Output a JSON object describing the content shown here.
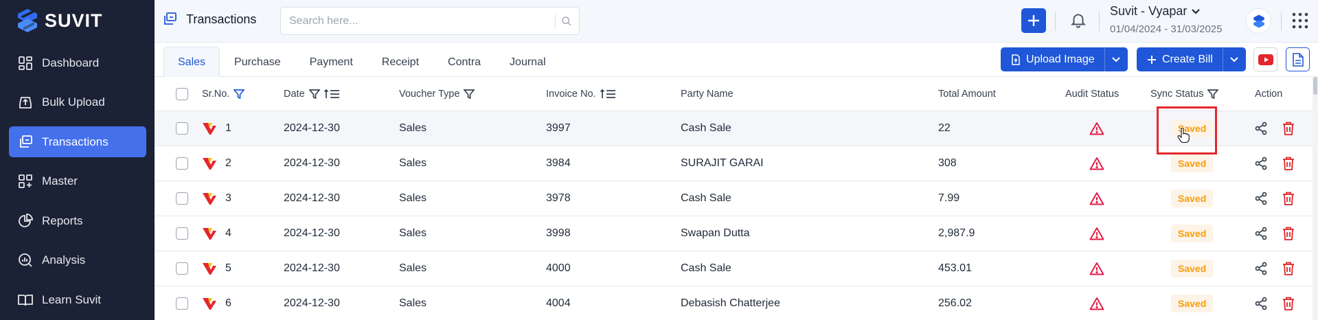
{
  "brand": {
    "name": "SUVIT"
  },
  "sidebar": {
    "items": [
      {
        "label": "Dashboard",
        "icon": "dashboard-icon",
        "active": false
      },
      {
        "label": "Bulk Upload",
        "icon": "upload-icon",
        "active": false
      },
      {
        "label": "Transactions",
        "icon": "transactions-icon",
        "active": true
      },
      {
        "label": "Master",
        "icon": "master-icon",
        "active": false
      },
      {
        "label": "Reports",
        "icon": "reports-icon",
        "active": false
      },
      {
        "label": "Analysis",
        "icon": "analysis-icon",
        "active": false
      },
      {
        "label": "Learn Suvit",
        "icon": "book-icon",
        "active": false
      }
    ]
  },
  "header": {
    "title": "Transactions",
    "search_placeholder": "Search here...",
    "company_name": "Suvit - Vyapar",
    "period": "01/04/2024 - 31/03/2025"
  },
  "tabs": [
    {
      "label": "Sales",
      "active": true
    },
    {
      "label": "Purchase",
      "active": false
    },
    {
      "label": "Payment",
      "active": false
    },
    {
      "label": "Receipt",
      "active": false
    },
    {
      "label": "Contra",
      "active": false
    },
    {
      "label": "Journal",
      "active": false
    }
  ],
  "actions": {
    "upload_image": "Upload Image",
    "create_bill": "Create Bill"
  },
  "table": {
    "columns": [
      "Sr.No.",
      "Date",
      "Voucher Type",
      "Invoice No.",
      "Party Name",
      "Total Amount",
      "Audit Status",
      "Sync Status",
      "Action"
    ],
    "rows": [
      {
        "sr": "1",
        "date": "2024-12-30",
        "voucher": "Sales",
        "invoice": "3997",
        "party": "Cash Sale",
        "amount": "22",
        "sync": "Saved"
      },
      {
        "sr": "2",
        "date": "2024-12-30",
        "voucher": "Sales",
        "invoice": "3984",
        "party": "SURAJIT GARAI",
        "amount": "308",
        "sync": "Saved"
      },
      {
        "sr": "3",
        "date": "2024-12-30",
        "voucher": "Sales",
        "invoice": "3978",
        "party": "Cash Sale",
        "amount": "7.99",
        "sync": "Saved"
      },
      {
        "sr": "4",
        "date": "2024-12-30",
        "voucher": "Sales",
        "invoice": "3998",
        "party": "Swapan Dutta",
        "amount": "2,987.9",
        "sync": "Saved"
      },
      {
        "sr": "5",
        "date": "2024-12-30",
        "voucher": "Sales",
        "invoice": "4000",
        "party": "Cash Sale",
        "amount": "453.01",
        "sync": "Saved"
      },
      {
        "sr": "6",
        "date": "2024-12-30",
        "voucher": "Sales",
        "invoice": "4004",
        "party": "Debasish Chatterjee",
        "amount": "256.02",
        "sync": "Saved"
      }
    ]
  },
  "colors": {
    "sidebar_bg": "#1b2236",
    "accent": "#1f57d8",
    "nav_active": "#4470ec",
    "warning": "#e11d48",
    "saved": "#f59e0b"
  }
}
